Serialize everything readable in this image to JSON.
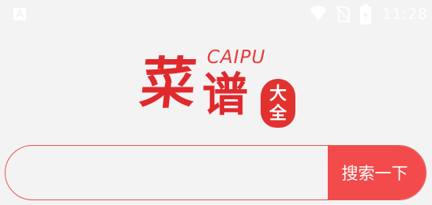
{
  "status_bar": {
    "time": "11:28",
    "icons": [
      "notification-icon",
      "wifi-icon",
      "no-sim-icon",
      "battery-icon"
    ],
    "icon_color": "#ffffff"
  },
  "logo": {
    "latin": "CAIPU",
    "char_1": "菜",
    "char_2": "谱",
    "seal_top": "大",
    "seal_bottom": "全",
    "color": "#e0292c"
  },
  "search": {
    "input_value": "",
    "placeholder": "",
    "button_label": "搜索一下",
    "accent_color": "#f34b4b"
  }
}
